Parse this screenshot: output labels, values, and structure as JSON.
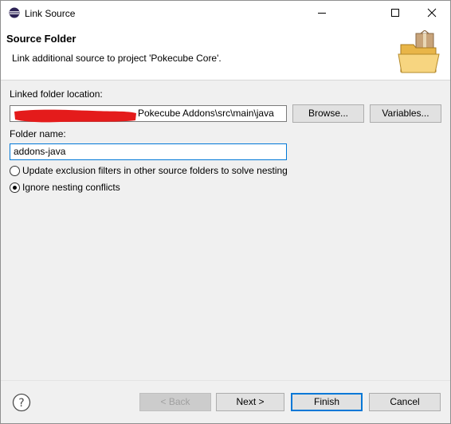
{
  "window": {
    "title": "Link Source",
    "minimize_icon": "minimize-icon",
    "maximize_icon": "maximize-icon",
    "close_icon": "close-icon",
    "app_icon": "eclipse-icon"
  },
  "banner": {
    "title": "Source Folder",
    "description": "Link additional source to project 'Pokecube Core'.",
    "image_icon": "folder-package-icon"
  },
  "form": {
    "linked_label": "Linked folder location:",
    "linked_value": "Pokecube Addons\\src\\main\\java",
    "browse_label": "Browse...",
    "variables_label": "Variables...",
    "folder_name_label": "Folder name:",
    "folder_name_value": "addons-java",
    "options": [
      {
        "label": "Update exclusion filters in other source folders to solve nesting",
        "checked": false
      },
      {
        "label": "Ignore nesting conflicts",
        "checked": true
      }
    ]
  },
  "footer": {
    "help_icon": "help-icon",
    "back_label": "< Back",
    "next_label": "Next >",
    "finish_label": "Finish",
    "cancel_label": "Cancel"
  },
  "colors": {
    "accent": "#0078d7",
    "redaction": "#e41b1b"
  }
}
